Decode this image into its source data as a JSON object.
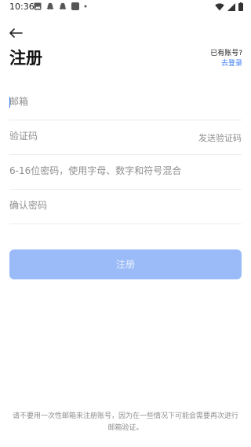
{
  "status_bar": {
    "time": "10:36",
    "left_icons": [
      "gallery-icon",
      "snapchat-icon",
      "snapchat-icon",
      "app-icon",
      "dot-icon"
    ],
    "right_icons": [
      "wifi-icon",
      "signal-icon",
      "battery-icon"
    ]
  },
  "header": {
    "title": "注册",
    "has_account": "已有账号?",
    "login_link": "去登录"
  },
  "form": {
    "email_placeholder": "邮箱",
    "code_placeholder": "验证码",
    "send_code_label": "发送验证码",
    "password_placeholder": "6-16位密码，使用字母、数字和符号混合",
    "confirm_placeholder": "确认密码",
    "submit_label": "注册"
  },
  "notice": "请不要用一次性邮箱来注册账号，因为在一些情况下可能会需要再次进行邮箱验证。",
  "colors": {
    "accent": "#3a7bf2",
    "button_disabled": "#9bbbf8"
  }
}
